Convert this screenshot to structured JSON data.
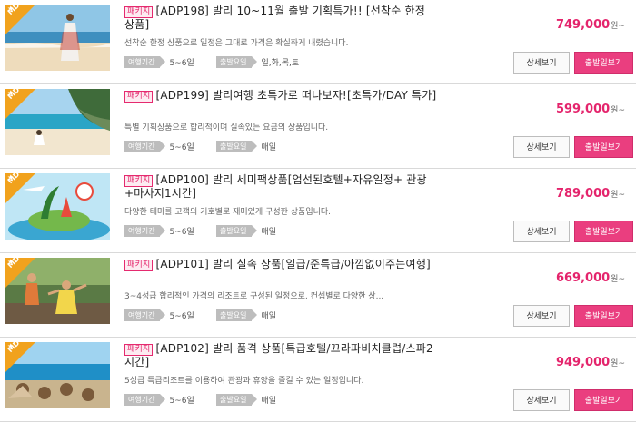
{
  "md_label": "MD추천",
  "colors": {
    "accent": "#e4246c",
    "badge": "#f1a21d"
  },
  "labels": {
    "travel_period": "여행기간",
    "departure_day": "출발요일",
    "detail_button": "상세보기",
    "departure_date_button": "출발일보기",
    "won_suffix": "원~",
    "package_tag": "패키지"
  },
  "products": [
    {
      "title": "[ADP198] 발리 10~11월 출발 기획특가!! [선착순 한정 상품]",
      "desc": "선착순 한정 상품으로 일정은 그대로 가격은 확실하게 내렸습니다.",
      "period": "5~6일",
      "days": "일,화,목,토",
      "price": "749,000",
      "image": "beach-woman"
    },
    {
      "title": "[ADP199] 발리여행 초특가로 떠나보자![초특가/DAY 특가]",
      "desc": "특별 기획상품으로 합리적이며 실속있는 요금의 상품입니다.",
      "period": "5~6일",
      "days": "매일",
      "price": "599,000",
      "image": "beach-cliff"
    },
    {
      "title": "[ADP100] 발리 세미팩상품[엄선된호텔+자유일정+ 관광+마사지1시간]",
      "desc": "다양한 테마를 고객의 기호별로 재미있게 구성한 상품입니다.",
      "period": "5~6일",
      "days": "매일",
      "price": "789,000",
      "image": "island-illustration"
    },
    {
      "title": "[ADP101] 발리 실속 상품[일급/준특급/아낌없이주는여행]",
      "desc": "3~4성급 합리적인 가격의 리조트로 구성된 일정으로, 컨셉별로 다양한 상...",
      "period": "5~6일",
      "days": "매일",
      "price": "669,000",
      "image": "tourists-jungle"
    },
    {
      "title": "[ADP102] 발리 품격 상품[특급호텔/끄라파비치클럽/스파2시간]",
      "desc": "5성급 특급리조트를 이용하여 관광과 휴양을 즐길 수 있는 일정입니다.",
      "period": "5~6일",
      "days": "매일",
      "price": "949,000",
      "image": "beach-club"
    }
  ]
}
